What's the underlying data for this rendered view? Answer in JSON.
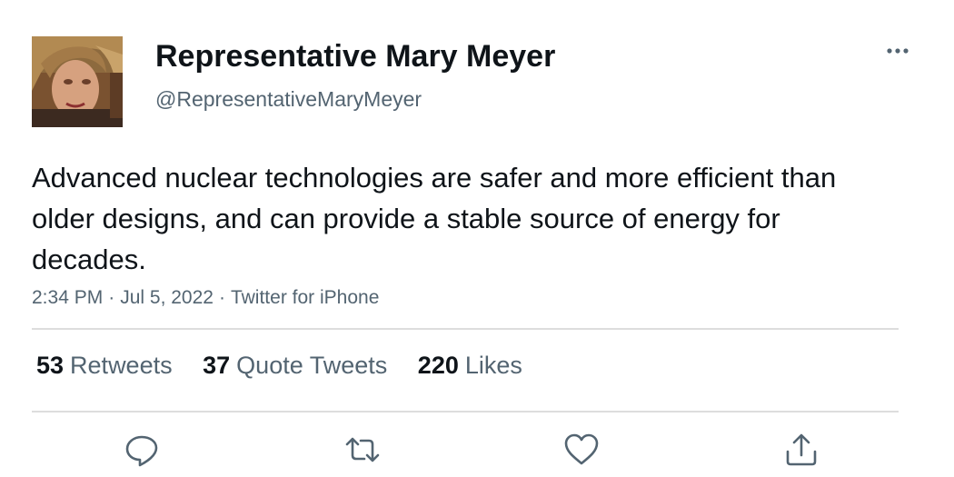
{
  "tweet": {
    "author": {
      "display_name": "Representative Mary Meyer",
      "handle": "@RepresentativeMaryMeyer"
    },
    "text": "Advanced nuclear technologies are safer and more efficient than older designs, and can provide a stable source of energy for decades.",
    "time": "2:34 PM",
    "date": "Jul 5, 2022",
    "source": "Twitter for iPhone",
    "separator": "·"
  },
  "stats": {
    "retweets": {
      "count": "53",
      "label": "Retweets"
    },
    "quote_tweets": {
      "count": "37",
      "label": "Quote Tweets"
    },
    "likes": {
      "count": "220",
      "label": "Likes"
    }
  },
  "icons": {
    "more": "more-icon",
    "reply": "reply-icon",
    "retweet": "retweet-icon",
    "like": "like-icon",
    "share": "share-icon"
  },
  "colors": {
    "text_primary": "#0f1419",
    "text_secondary": "#536471",
    "divider": "#dddddd",
    "icon": "#536471"
  }
}
